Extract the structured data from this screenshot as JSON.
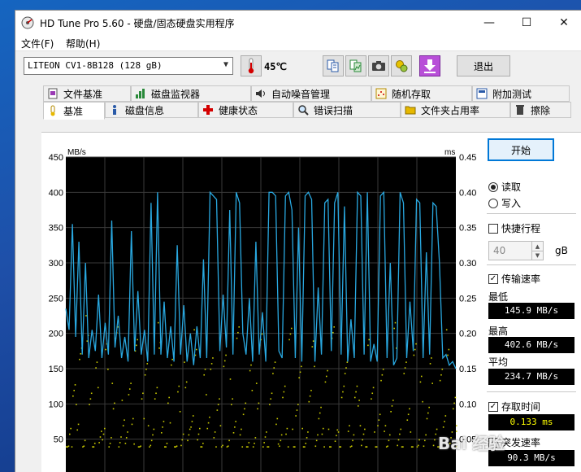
{
  "window": {
    "title": "HD Tune Pro 5.60 - 硬盘/固态硬盘实用程序",
    "minimize": "—",
    "maximize": "☐",
    "close": "✕"
  },
  "menu": {
    "file": "文件(F)",
    "help": "帮助(H)"
  },
  "toolbar": {
    "drive": "LITEON CV1-8B128 (128 gB)",
    "temperature": "45℃",
    "exit_label": "退出",
    "icons": [
      "thermometer-icon",
      "copy-text-icon",
      "copy-image-icon",
      "camera-icon",
      "options-icon",
      "save-down-icon"
    ]
  },
  "tabs_top": [
    {
      "label": "文件基准",
      "icon": "file-benchmark-icon"
    },
    {
      "label": "磁盘监视器",
      "icon": "disk-monitor-icon"
    },
    {
      "label": "自动噪音管理",
      "icon": "speaker-icon"
    },
    {
      "label": "随机存取",
      "icon": "random-access-icon"
    },
    {
      "label": "附加测试",
      "icon": "extra-tests-icon"
    }
  ],
  "tabs_bottom": [
    {
      "label": "基准",
      "icon": "benchmark-icon"
    },
    {
      "label": "磁盘信息",
      "icon": "info-icon"
    },
    {
      "label": "健康状态",
      "icon": "health-cross-icon"
    },
    {
      "label": "错误扫描",
      "icon": "magnifier-icon"
    },
    {
      "label": "文件夹占用率",
      "icon": "folder-icon"
    },
    {
      "label": "擦除",
      "icon": "trash-icon"
    }
  ],
  "controls": {
    "start_label": "开始",
    "read_label": "读取",
    "write_label": "写入",
    "mode": "read",
    "short_stroke_label": "快捷行程",
    "short_stroke_checked": false,
    "short_stroke_value": "40",
    "short_stroke_unit": "gB",
    "transfer_rate_label": "传输速率",
    "transfer_rate_checked": true,
    "min_label": "最低",
    "min_value": "145.9 MB/s",
    "max_label": "最高",
    "max_value": "402.6 MB/s",
    "avg_label": "平均",
    "avg_value": "234.7 MB/s",
    "access_time_label": "存取时间",
    "access_time_checked": true,
    "access_time_value": "0.133 ms",
    "burst_label": "突发速率",
    "burst_checked": true,
    "burst_value": "90.3 MB/s"
  },
  "watermark": "Bai 经验",
  "colors": {
    "transfer_line": "#29a8e0",
    "access_dots": "#c8c800",
    "chart_bg": "#000000",
    "grid": "#3a3a3a",
    "accent": "#0078d7"
  },
  "chart_data": {
    "type": "line",
    "title": "",
    "xlabel": "",
    "ylabel": "MB/s",
    "y2label": "ms",
    "ylim": [
      0,
      450
    ],
    "y2lim": [
      0,
      0.45
    ],
    "yticks": [
      50,
      100,
      150,
      200,
      250,
      300,
      350,
      400,
      450
    ],
    "y2ticks": [
      "0.05",
      "0.10",
      "0.15",
      "0.20",
      "0.25",
      "0.30",
      "0.35",
      "0.40",
      "0.45"
    ],
    "x": [
      0,
      1,
      2,
      3,
      4,
      5,
      6,
      7,
      8,
      9,
      10,
      11,
      12,
      13,
      14,
      15,
      16,
      17,
      18,
      19,
      20,
      21,
      22,
      23,
      24,
      25,
      26,
      27,
      28,
      29,
      30,
      31,
      32,
      33,
      34,
      35,
      36,
      37,
      38,
      39,
      40,
      41,
      42,
      43,
      44,
      45,
      46,
      47,
      48,
      49,
      50,
      51,
      52,
      53,
      54,
      55,
      56,
      57,
      58,
      59,
      60,
      61,
      62,
      63,
      64,
      65,
      66,
      67,
      68,
      69,
      70,
      71,
      72,
      73,
      74,
      75,
      76,
      77,
      78,
      79,
      80,
      81,
      82,
      83,
      84,
      85,
      86,
      87,
      88,
      89,
      90,
      91,
      92,
      93,
      94,
      95,
      96,
      97,
      98,
      99,
      100,
      101,
      102,
      103,
      104,
      105,
      106,
      107,
      108,
      109,
      110,
      111,
      112,
      113,
      114,
      115,
      116,
      117,
      118,
      119
    ],
    "series": [
      {
        "name": "传输速率",
        "values": [
          235,
          205,
          355,
          195,
          330,
          170,
          300,
          165,
          205,
          175,
          255,
          165,
          215,
          170,
          360,
          180,
          225,
          165,
          195,
          160,
          345,
          175,
          260,
          170,
          205,
          160,
          385,
          170,
          400,
          170,
          245,
          165,
          210,
          160,
          325,
          170,
          240,
          160,
          200,
          155,
          210,
          165,
          305,
          165,
          400,
          395,
          390,
          175,
          255,
          180,
          375,
          170,
          400,
          385,
          200,
          170,
          250,
          160,
          330,
          170,
          230,
          160,
          400,
          400,
          395,
          175,
          165,
          395,
          400,
          375,
          165,
          350,
          160,
          395,
          400,
          390,
          160,
          265,
          170,
          385,
          390,
          175,
          385,
          400,
          170,
          380,
          160,
          220,
          165,
          400,
          395,
          170,
          400,
          160,
          185,
          160,
          395,
          400,
          165,
          300,
          155,
          165,
          400,
          385,
          165,
          245,
          175,
          390,
          385,
          165,
          315,
          170,
          385,
          380,
          300,
          165,
          170,
          155,
          160,
          150
        ]
      },
      {
        "name": "存取时间",
        "unit": "ms",
        "values": [
          0.045,
          0.05,
          0.12,
          0.08,
          0.16,
          0.045,
          0.21,
          0.1,
          0.045,
          0.14,
          0.05,
          0.07,
          0.17,
          0.045,
          0.11,
          0.19,
          0.05,
          0.09,
          0.045,
          0.13,
          0.06,
          0.18,
          0.045,
          0.1,
          0.15,
          0.05,
          0.045,
          0.12,
          0.2,
          0.06,
          0.045,
          0.09,
          0.16,
          0.045,
          0.11,
          0.05,
          0.14,
          0.045,
          0.08,
          0.19,
          0.05,
          0.045,
          0.13,
          0.07,
          0.17,
          0.045,
          0.1,
          0.05,
          0.15,
          0.045,
          0.12,
          0.06,
          0.21,
          0.045,
          0.09,
          0.05,
          0.14,
          0.045,
          0.11,
          0.18,
          0.05,
          0.045,
          0.1,
          0.16,
          0.06,
          0.045,
          0.13,
          0.05,
          0.2,
          0.045,
          0.08,
          0.15,
          0.05,
          0.045,
          0.12,
          0.17,
          0.045,
          0.1,
          0.05,
          0.14,
          0.045,
          0.19,
          0.06,
          0.045,
          0.11,
          0.16,
          0.05,
          0.045,
          0.13,
          0.09,
          0.05,
          0.045,
          0.18,
          0.12,
          0.045,
          0.07,
          0.15,
          0.05,
          0.045,
          0.11,
          0.2,
          0.05,
          0.045,
          0.14,
          0.09,
          0.045,
          0.17,
          0.05,
          0.12,
          0.045,
          0.1,
          0.15,
          0.05,
          0.045,
          0.13,
          0.08,
          0.19,
          0.045,
          0.11,
          0.05
        ]
      }
    ]
  }
}
